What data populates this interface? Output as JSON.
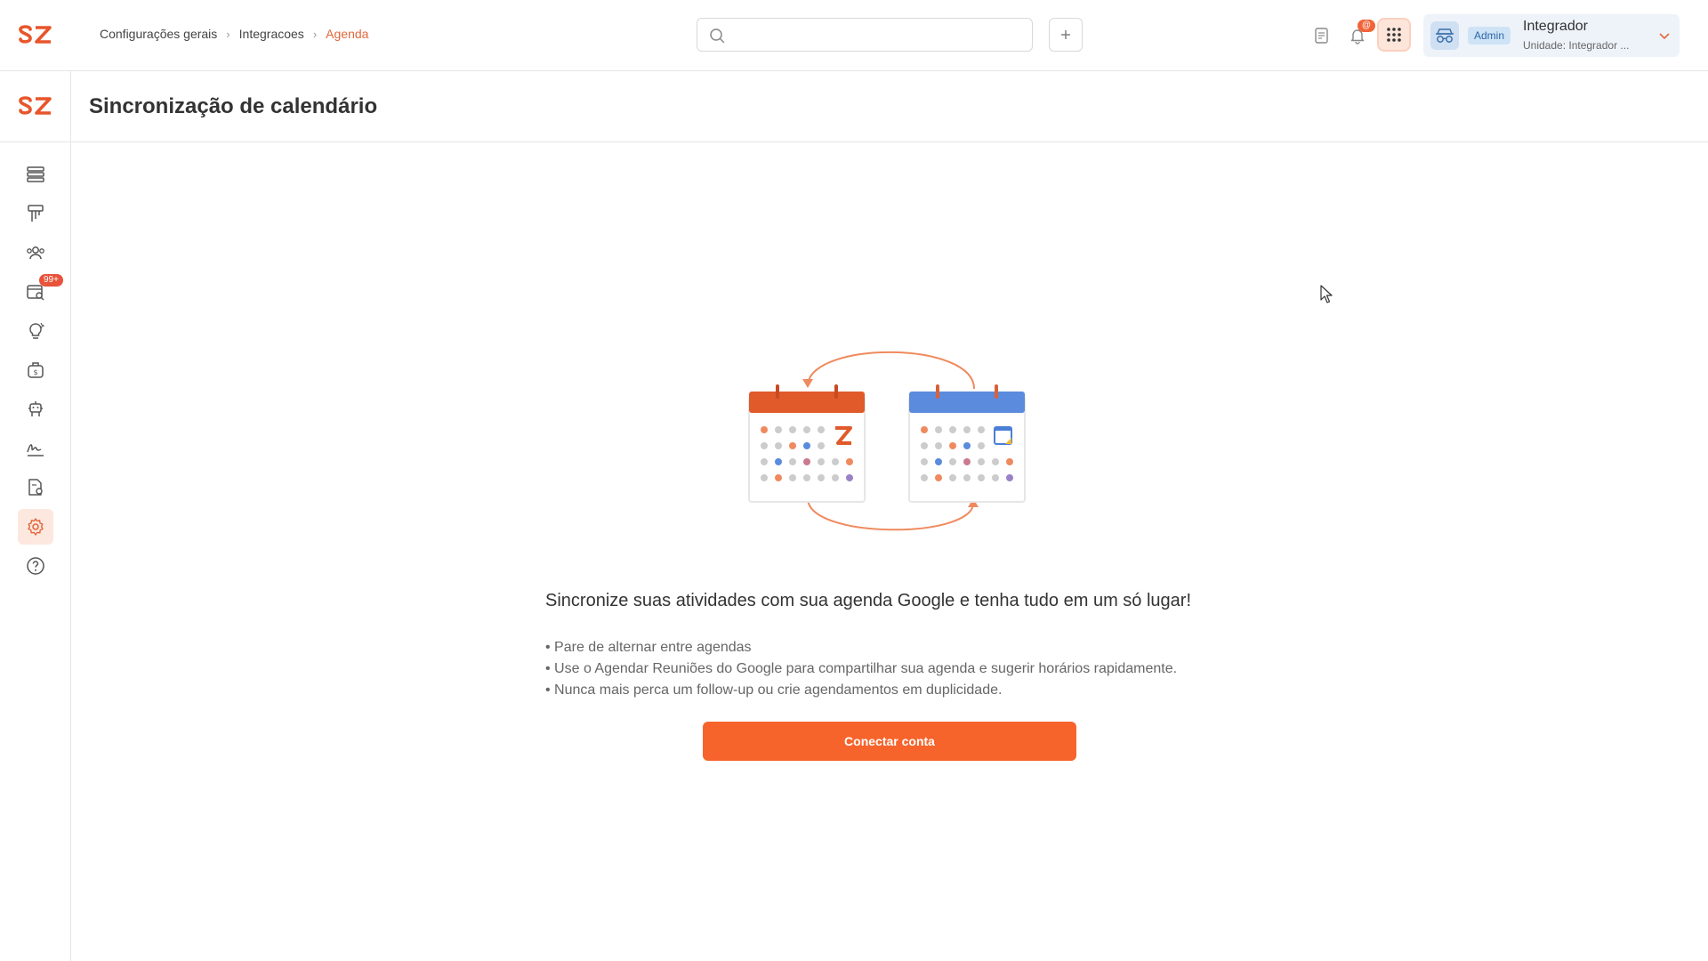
{
  "header": {
    "logo_text": "SZ",
    "breadcrumb": [
      "Configurações gerais",
      "Integracoes",
      "Agenda"
    ],
    "search": {
      "value": "",
      "placeholder": ""
    },
    "notifications_badge": "@",
    "user": {
      "role_badge": "Admin",
      "name": "Integrador",
      "unit": "Unidade: Integrador ..."
    }
  },
  "sidebar": {
    "items": [
      {
        "icon": "list-icon"
      },
      {
        "icon": "signpost-icon"
      },
      {
        "icon": "users-icon"
      },
      {
        "icon": "inbox-search-icon",
        "badge": "99+"
      },
      {
        "icon": "lightbulb-icon"
      },
      {
        "icon": "money-bag-icon"
      },
      {
        "icon": "robot-icon"
      },
      {
        "icon": "signature-icon"
      },
      {
        "icon": "document-settings-icon"
      },
      {
        "icon": "gear-icon",
        "active": true
      },
      {
        "icon": "help-icon"
      }
    ]
  },
  "page": {
    "title": "Sincronização de calendário",
    "headline": "Sincronize suas atividades com sua agenda Google e tenha tudo em um só lugar!",
    "bullets": [
      "• Pare de alternar entre agendas",
      "• Use o Agendar Reuniões do Google para compartilhar sua agenda e sugerir horários rapidamente.",
      "• Nunca mais perca um follow-up ou crie agendamentos em duplicidade."
    ],
    "connect_button": "Conectar conta"
  },
  "colors": {
    "brand": "#f7642b",
    "breadcrumb_active": "#e2683c",
    "calendar_left": "#e05a2a",
    "calendar_right": "#5b8bdc",
    "admin_badge": "#cfe3f7"
  }
}
